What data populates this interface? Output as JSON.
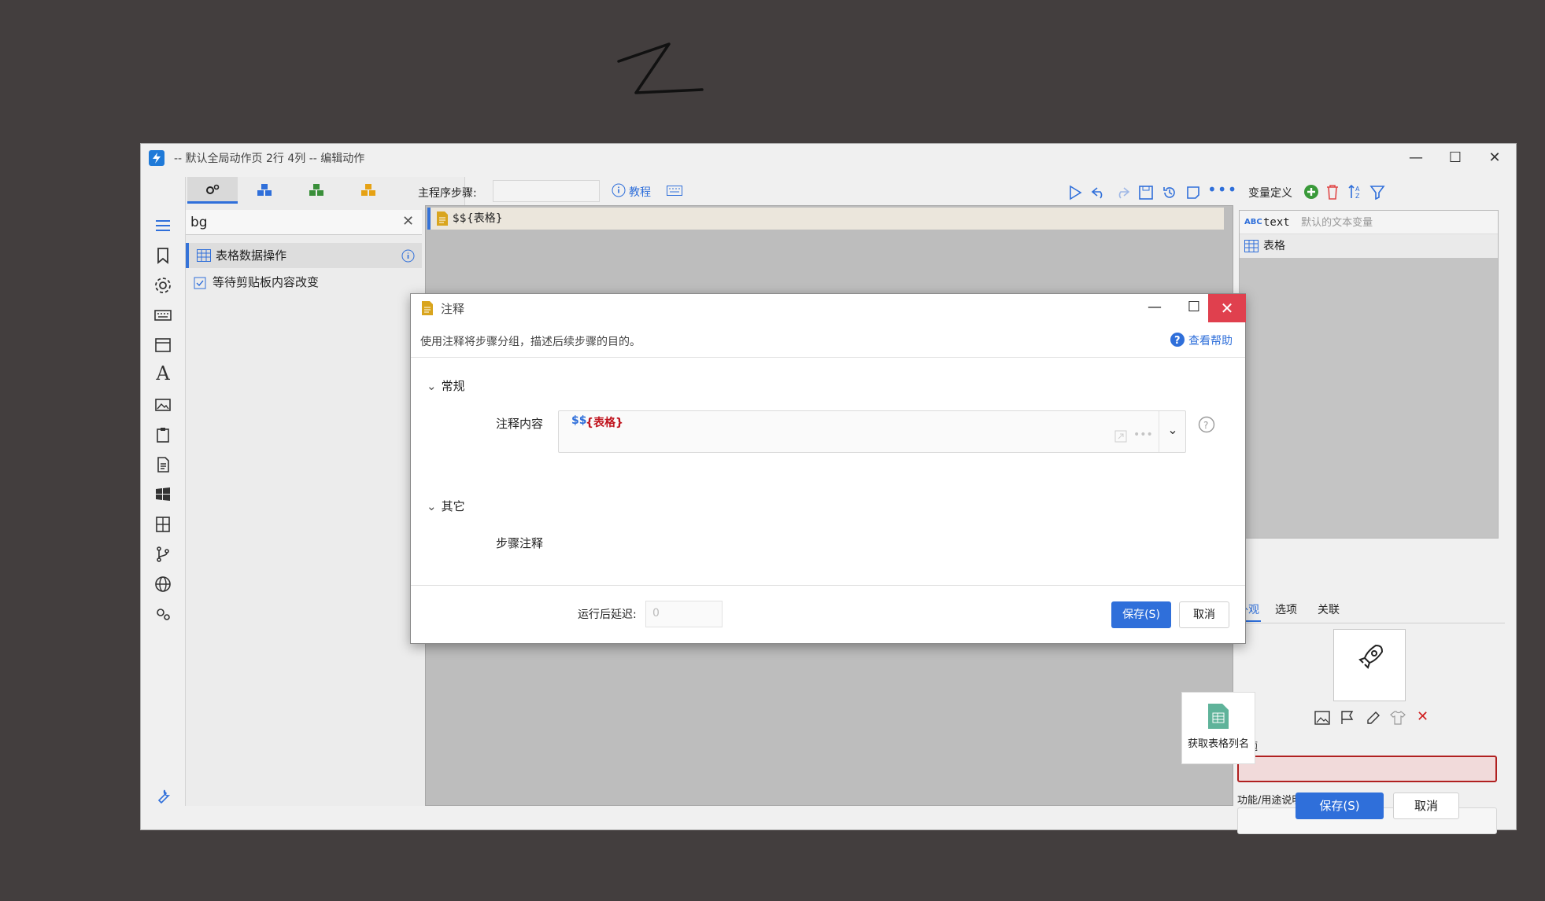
{
  "window": {
    "title": "-- 默认全局动作页 2行 4列 -- 编辑动作",
    "controls": [
      "minimize",
      "maximize",
      "close"
    ]
  },
  "left_panel": {
    "search_value": "bg",
    "items": [
      {
        "label": "表格数据操作",
        "selected": true
      },
      {
        "label": "等待剪贴板内容改变",
        "selected": false
      }
    ]
  },
  "center": {
    "main_steps_label": "主程序步骤:",
    "tutorial_label": "教程",
    "step_text": "$${表格}"
  },
  "right_panel": {
    "var_def_label": "变量定义",
    "vars": [
      {
        "type": "ABC",
        "name": "text",
        "desc": "默认的文本变量"
      },
      {
        "type": "table",
        "name": "表格",
        "desc": ""
      }
    ],
    "tabs": [
      "外观",
      "选项",
      "关联"
    ],
    "title_label": "标题",
    "desc_label": "功能/用途说明",
    "save_label": "保存(S)",
    "cancel_label": "取消"
  },
  "dialog": {
    "title": "注释",
    "description": "使用注释将步骤分组，描述后续步骤的目的。",
    "help_label": "查看帮助",
    "section_general": "常规",
    "field_label": "注释内容",
    "field_value_prefix": "$$",
    "field_value_var": "{表格}",
    "section_other": "其它",
    "step_note_label": "步骤注释",
    "delay_label": "运行后延迟:",
    "delay_placeholder": "0",
    "save_label": "保存(S)",
    "cancel_label": "取消"
  },
  "tooltip": {
    "label": "获取表格列名"
  },
  "colors": {
    "accent": "#2f6fda",
    "close_red": "#e0404e",
    "variable_red": "#c0141e",
    "background": "#433e3e"
  }
}
